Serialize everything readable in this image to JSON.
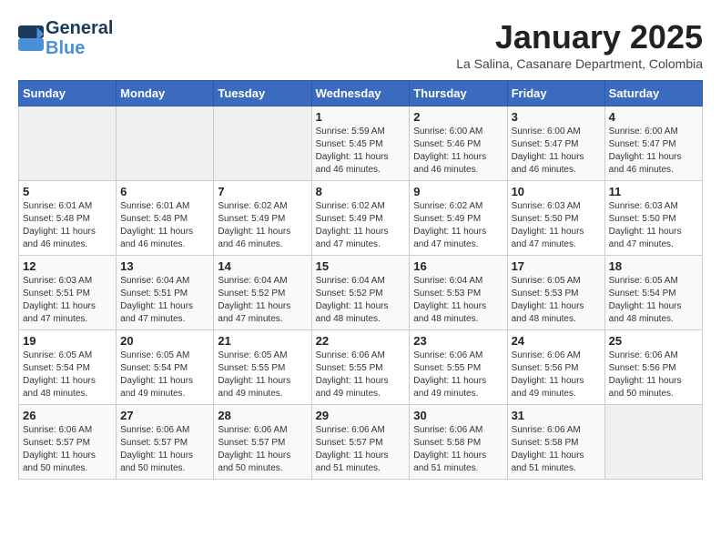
{
  "header": {
    "logo_line1": "General",
    "logo_line2": "Blue",
    "month_title": "January 2025",
    "subtitle": "La Salina, Casanare Department, Colombia"
  },
  "days_of_week": [
    "Sunday",
    "Monday",
    "Tuesday",
    "Wednesday",
    "Thursday",
    "Friday",
    "Saturday"
  ],
  "weeks": [
    [
      {
        "day": "",
        "sunrise": "",
        "sunset": "",
        "daylight": ""
      },
      {
        "day": "",
        "sunrise": "",
        "sunset": "",
        "daylight": ""
      },
      {
        "day": "",
        "sunrise": "",
        "sunset": "",
        "daylight": ""
      },
      {
        "day": "1",
        "sunrise": "Sunrise: 5:59 AM",
        "sunset": "Sunset: 5:45 PM",
        "daylight": "Daylight: 11 hours and 46 minutes."
      },
      {
        "day": "2",
        "sunrise": "Sunrise: 6:00 AM",
        "sunset": "Sunset: 5:46 PM",
        "daylight": "Daylight: 11 hours and 46 minutes."
      },
      {
        "day": "3",
        "sunrise": "Sunrise: 6:00 AM",
        "sunset": "Sunset: 5:47 PM",
        "daylight": "Daylight: 11 hours and 46 minutes."
      },
      {
        "day": "4",
        "sunrise": "Sunrise: 6:00 AM",
        "sunset": "Sunset: 5:47 PM",
        "daylight": "Daylight: 11 hours and 46 minutes."
      }
    ],
    [
      {
        "day": "5",
        "sunrise": "Sunrise: 6:01 AM",
        "sunset": "Sunset: 5:48 PM",
        "daylight": "Daylight: 11 hours and 46 minutes."
      },
      {
        "day": "6",
        "sunrise": "Sunrise: 6:01 AM",
        "sunset": "Sunset: 5:48 PM",
        "daylight": "Daylight: 11 hours and 46 minutes."
      },
      {
        "day": "7",
        "sunrise": "Sunrise: 6:02 AM",
        "sunset": "Sunset: 5:49 PM",
        "daylight": "Daylight: 11 hours and 46 minutes."
      },
      {
        "day": "8",
        "sunrise": "Sunrise: 6:02 AM",
        "sunset": "Sunset: 5:49 PM",
        "daylight": "Daylight: 11 hours and 47 minutes."
      },
      {
        "day": "9",
        "sunrise": "Sunrise: 6:02 AM",
        "sunset": "Sunset: 5:49 PM",
        "daylight": "Daylight: 11 hours and 47 minutes."
      },
      {
        "day": "10",
        "sunrise": "Sunrise: 6:03 AM",
        "sunset": "Sunset: 5:50 PM",
        "daylight": "Daylight: 11 hours and 47 minutes."
      },
      {
        "day": "11",
        "sunrise": "Sunrise: 6:03 AM",
        "sunset": "Sunset: 5:50 PM",
        "daylight": "Daylight: 11 hours and 47 minutes."
      }
    ],
    [
      {
        "day": "12",
        "sunrise": "Sunrise: 6:03 AM",
        "sunset": "Sunset: 5:51 PM",
        "daylight": "Daylight: 11 hours and 47 minutes."
      },
      {
        "day": "13",
        "sunrise": "Sunrise: 6:04 AM",
        "sunset": "Sunset: 5:51 PM",
        "daylight": "Daylight: 11 hours and 47 minutes."
      },
      {
        "day": "14",
        "sunrise": "Sunrise: 6:04 AM",
        "sunset": "Sunset: 5:52 PM",
        "daylight": "Daylight: 11 hours and 47 minutes."
      },
      {
        "day": "15",
        "sunrise": "Sunrise: 6:04 AM",
        "sunset": "Sunset: 5:52 PM",
        "daylight": "Daylight: 11 hours and 48 minutes."
      },
      {
        "day": "16",
        "sunrise": "Sunrise: 6:04 AM",
        "sunset": "Sunset: 5:53 PM",
        "daylight": "Daylight: 11 hours and 48 minutes."
      },
      {
        "day": "17",
        "sunrise": "Sunrise: 6:05 AM",
        "sunset": "Sunset: 5:53 PM",
        "daylight": "Daylight: 11 hours and 48 minutes."
      },
      {
        "day": "18",
        "sunrise": "Sunrise: 6:05 AM",
        "sunset": "Sunset: 5:54 PM",
        "daylight": "Daylight: 11 hours and 48 minutes."
      }
    ],
    [
      {
        "day": "19",
        "sunrise": "Sunrise: 6:05 AM",
        "sunset": "Sunset: 5:54 PM",
        "daylight": "Daylight: 11 hours and 48 minutes."
      },
      {
        "day": "20",
        "sunrise": "Sunrise: 6:05 AM",
        "sunset": "Sunset: 5:54 PM",
        "daylight": "Daylight: 11 hours and 49 minutes."
      },
      {
        "day": "21",
        "sunrise": "Sunrise: 6:05 AM",
        "sunset": "Sunset: 5:55 PM",
        "daylight": "Daylight: 11 hours and 49 minutes."
      },
      {
        "day": "22",
        "sunrise": "Sunrise: 6:06 AM",
        "sunset": "Sunset: 5:55 PM",
        "daylight": "Daylight: 11 hours and 49 minutes."
      },
      {
        "day": "23",
        "sunrise": "Sunrise: 6:06 AM",
        "sunset": "Sunset: 5:55 PM",
        "daylight": "Daylight: 11 hours and 49 minutes."
      },
      {
        "day": "24",
        "sunrise": "Sunrise: 6:06 AM",
        "sunset": "Sunset: 5:56 PM",
        "daylight": "Daylight: 11 hours and 49 minutes."
      },
      {
        "day": "25",
        "sunrise": "Sunrise: 6:06 AM",
        "sunset": "Sunset: 5:56 PM",
        "daylight": "Daylight: 11 hours and 50 minutes."
      }
    ],
    [
      {
        "day": "26",
        "sunrise": "Sunrise: 6:06 AM",
        "sunset": "Sunset: 5:57 PM",
        "daylight": "Daylight: 11 hours and 50 minutes."
      },
      {
        "day": "27",
        "sunrise": "Sunrise: 6:06 AM",
        "sunset": "Sunset: 5:57 PM",
        "daylight": "Daylight: 11 hours and 50 minutes."
      },
      {
        "day": "28",
        "sunrise": "Sunrise: 6:06 AM",
        "sunset": "Sunset: 5:57 PM",
        "daylight": "Daylight: 11 hours and 50 minutes."
      },
      {
        "day": "29",
        "sunrise": "Sunrise: 6:06 AM",
        "sunset": "Sunset: 5:57 PM",
        "daylight": "Daylight: 11 hours and 51 minutes."
      },
      {
        "day": "30",
        "sunrise": "Sunrise: 6:06 AM",
        "sunset": "Sunset: 5:58 PM",
        "daylight": "Daylight: 11 hours and 51 minutes."
      },
      {
        "day": "31",
        "sunrise": "Sunrise: 6:06 AM",
        "sunset": "Sunset: 5:58 PM",
        "daylight": "Daylight: 11 hours and 51 minutes."
      },
      {
        "day": "",
        "sunrise": "",
        "sunset": "",
        "daylight": ""
      }
    ]
  ]
}
